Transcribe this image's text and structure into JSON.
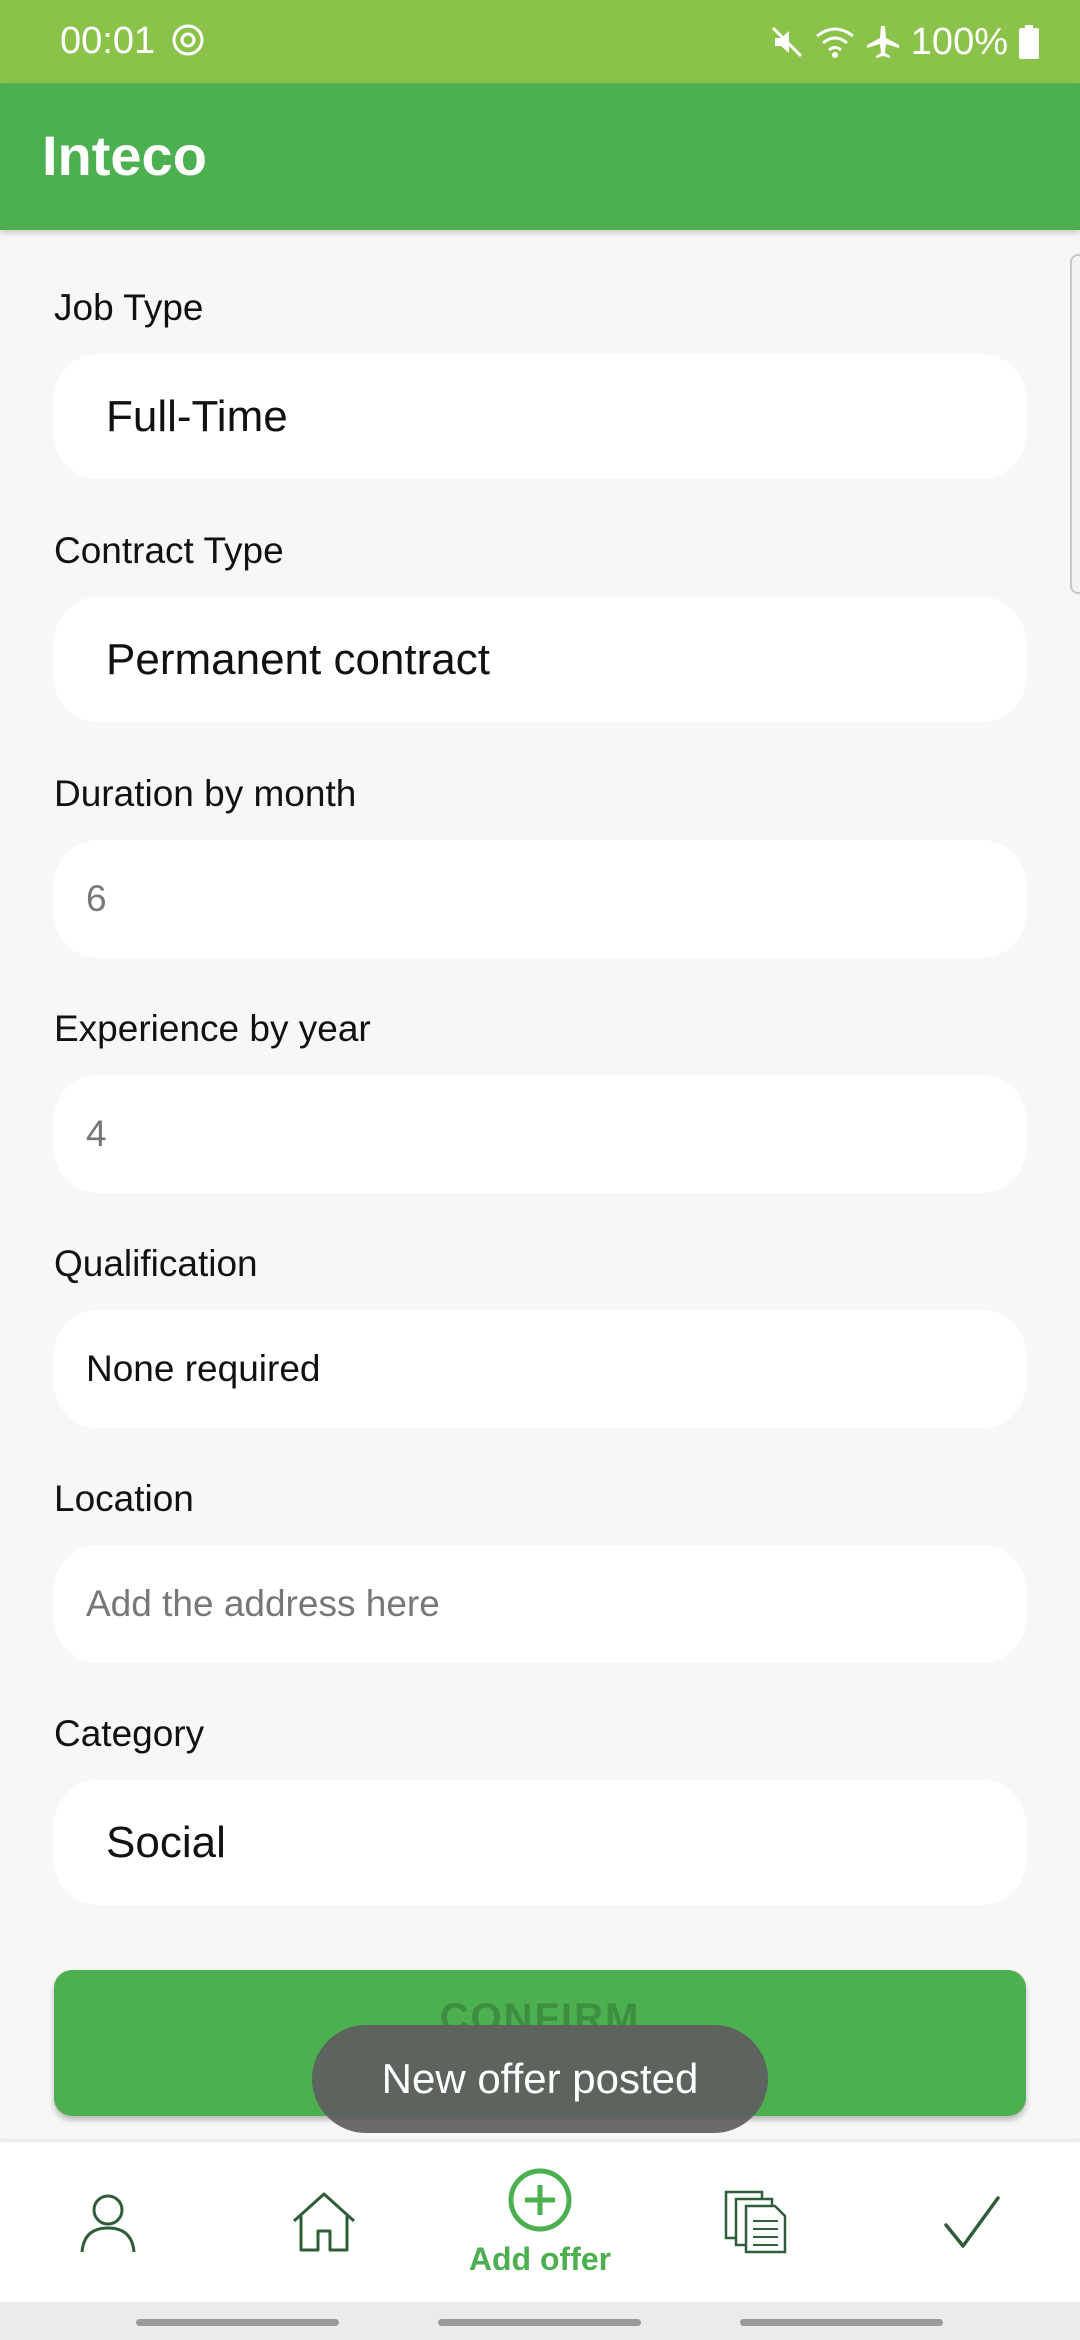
{
  "status": {
    "time": "00:01",
    "battery": "100%"
  },
  "app": {
    "title": "Inteco"
  },
  "form": {
    "job_type": {
      "label": "Job Type",
      "value": "Full-Time"
    },
    "contract_type": {
      "label": "Contract Type",
      "value": "Permanent contract"
    },
    "duration": {
      "label": "Duration by month",
      "value": "6"
    },
    "experience": {
      "label": "Experience by year",
      "value": "4"
    },
    "qualification": {
      "label": "Qualification",
      "value": "None required"
    },
    "location": {
      "label": "Location",
      "placeholder": "Add the address here"
    },
    "category": {
      "label": "Category",
      "value": "Social"
    },
    "confirm_label": "CONFIRM"
  },
  "toast": {
    "text": "New offer posted"
  },
  "nav": {
    "items": [
      {
        "icon": "profile-icon"
      },
      {
        "icon": "home-icon"
      },
      {
        "icon": "add-circle-icon",
        "label": "Add offer"
      },
      {
        "icon": "documents-icon"
      },
      {
        "icon": "checkmark-icon"
      }
    ]
  },
  "colors": {
    "accent": "#4caf50",
    "status_bar": "#8bc34a"
  }
}
